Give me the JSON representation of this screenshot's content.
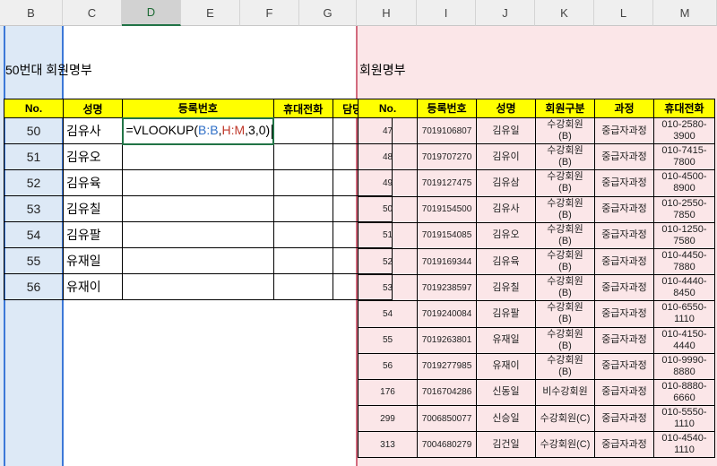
{
  "column_headers": [
    "B",
    "C",
    "D",
    "E",
    "F",
    "G",
    "H",
    "I",
    "J",
    "K",
    "L",
    "M"
  ],
  "active_column": "D",
  "left_title": "50번대 회원명부",
  "right_title": "회원명부",
  "left_table": {
    "headers": [
      "No.",
      "성명",
      "등록번호",
      "휴대전화",
      "담당강사"
    ],
    "formula": {
      "prefix": "=VLOOKUP(",
      "ref1": "B:B",
      "sep1": ",",
      "ref2": "H:M",
      "suffix": ",3,0)"
    },
    "rows": [
      {
        "no": "50",
        "name": "김유사"
      },
      {
        "no": "51",
        "name": "김유오"
      },
      {
        "no": "52",
        "name": "김유육"
      },
      {
        "no": "53",
        "name": "김유칠"
      },
      {
        "no": "54",
        "name": "김유팔"
      },
      {
        "no": "55",
        "name": "유재일"
      },
      {
        "no": "56",
        "name": "유재이"
      }
    ]
  },
  "right_table": {
    "headers": [
      "No.",
      "등록번호",
      "성명",
      "회원구분",
      "과정",
      "휴대전화"
    ],
    "rows": [
      {
        "no": "47",
        "reg": "7019106807",
        "name": "김유일",
        "type": "수강회원\n(B)",
        "course": "중급자과정",
        "phone": "010-2580-\n3900"
      },
      {
        "no": "48",
        "reg": "7019707270",
        "name": "김유이",
        "type": "수강회원\n(B)",
        "course": "중급자과정",
        "phone": "010-7415-\n7800"
      },
      {
        "no": "49",
        "reg": "7019127475",
        "name": "김유삼",
        "type": "수강회원\n(B)",
        "course": "중급자과정",
        "phone": "010-4500-\n8900"
      },
      {
        "no": "50",
        "reg": "7019154500",
        "name": "김유사",
        "type": "수강회원\n(B)",
        "course": "중급자과정",
        "phone": "010-2550-\n7850"
      },
      {
        "no": "51",
        "reg": "7019154085",
        "name": "김유오",
        "type": "수강회원\n(B)",
        "course": "중급자과정",
        "phone": "010-1250-\n7580"
      },
      {
        "no": "52",
        "reg": "7019169344",
        "name": "김유육",
        "type": "수강회원\n(B)",
        "course": "중급자과정",
        "phone": "010-4450-\n7880"
      },
      {
        "no": "53",
        "reg": "7019238597",
        "name": "김유칠",
        "type": "수강회원\n(B)",
        "course": "중급자과정",
        "phone": "010-4440-\n8450"
      },
      {
        "no": "54",
        "reg": "7019240084",
        "name": "김유팔",
        "type": "수강회원\n(B)",
        "course": "중급자과정",
        "phone": "010-6550-\n1110"
      },
      {
        "no": "55",
        "reg": "7019263801",
        "name": "유재일",
        "type": "수강회원\n(B)",
        "course": "중급자과정",
        "phone": "010-4150-\n4440"
      },
      {
        "no": "56",
        "reg": "7019277985",
        "name": "유재이",
        "type": "수강회원\n(B)",
        "course": "중급자과정",
        "phone": "010-9990-\n8880"
      },
      {
        "no": "176",
        "reg": "7016704286",
        "name": "신동일",
        "type": "비수강회원",
        "course": "중급자과정",
        "phone": "010-8880-\n6660"
      },
      {
        "no": "299",
        "reg": "7006850077",
        "name": "신승일",
        "type": "수강회원(C)",
        "course": "중급자과정",
        "phone": "010-5550-\n1110"
      },
      {
        "no": "313",
        "reg": "7004680279",
        "name": "김건일",
        "type": "수강회원(C)",
        "course": "중급자과정",
        "phone": "010-4540-\n1110"
      }
    ]
  }
}
